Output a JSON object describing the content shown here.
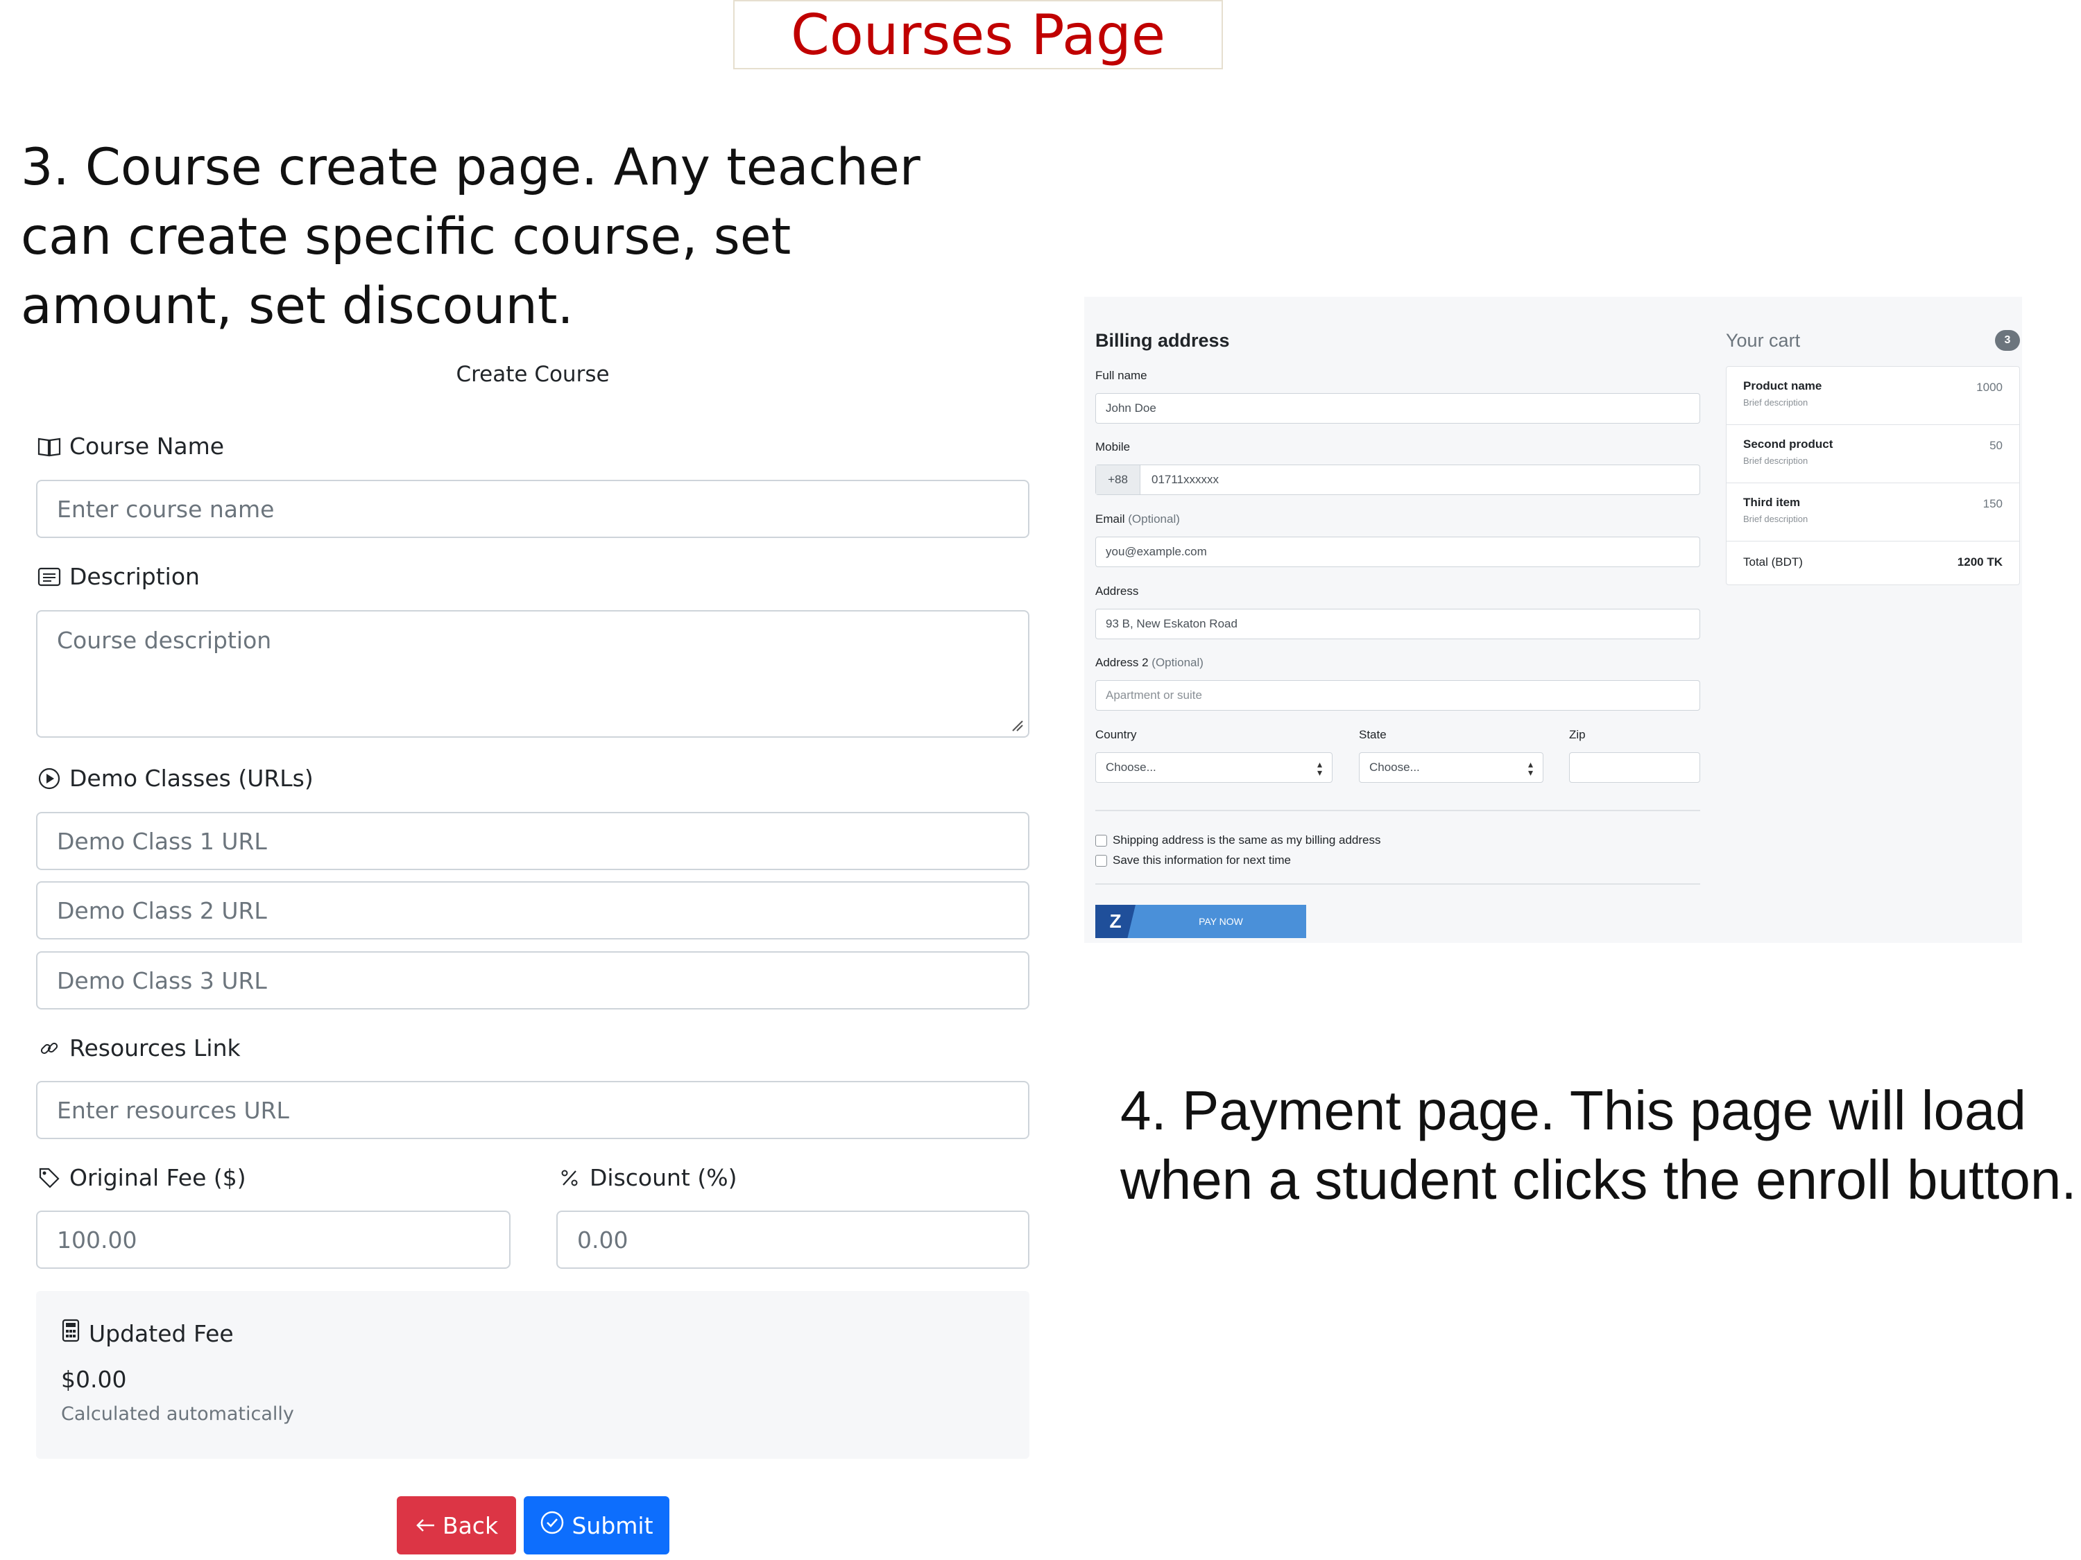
{
  "slide": {
    "title": "Courses Page",
    "caption_left": "3. Course create page. Any teacher can create specific course, set amount, set discount.",
    "caption_right": "4. Payment page. This page will load when a student clicks the enroll button."
  },
  "create_course": {
    "heading": "Create Course",
    "course_name": {
      "label": "Course Name",
      "icon": "book-icon",
      "placeholder": "Enter course name"
    },
    "description": {
      "label": "Description",
      "icon": "text-icon",
      "placeholder": "Course description"
    },
    "demo_classes": {
      "label": "Demo Classes (URLs)",
      "icon": "play-circle-icon",
      "placeholders": [
        "Demo Class 1 URL",
        "Demo Class 2 URL",
        "Demo Class 3 URL"
      ]
    },
    "resources": {
      "label": "Resources Link",
      "icon": "link-icon",
      "placeholder": "Enter resources URL"
    },
    "original_fee": {
      "label": "Original Fee ($)",
      "icon": "tag-icon",
      "value": "100.00"
    },
    "discount": {
      "label": "Discount (%)",
      "icon": "percent-icon",
      "value": "0.00"
    },
    "updated_fee": {
      "label": "Updated Fee",
      "icon": "calculator-icon",
      "value": "$0.00",
      "note": "Calculated automatically"
    },
    "back_button": "Back",
    "submit_button": "Submit"
  },
  "payment": {
    "billing_heading": "Billing address",
    "full_name": {
      "label": "Full name",
      "value": "John Doe"
    },
    "mobile": {
      "label": "Mobile",
      "prefix": "+88",
      "value": "01711xxxxxx"
    },
    "email": {
      "label": "Email",
      "optional": "(Optional)",
      "placeholder": "you@example.com"
    },
    "address": {
      "label": "Address",
      "value": "93 B, New Eskaton Road"
    },
    "address2": {
      "label": "Address 2",
      "optional": "(Optional)",
      "placeholder": "Apartment or suite"
    },
    "country": {
      "label": "Country",
      "selected": "Choose..."
    },
    "state": {
      "label": "State",
      "selected": "Choose..."
    },
    "zip": {
      "label": "Zip",
      "value": ""
    },
    "checkboxes": [
      "Shipping address is the same as my billing address",
      "Save this information for next time"
    ],
    "pay_button": {
      "logo": "Z",
      "label": "PAY NOW"
    },
    "cart": {
      "heading": "Your cart",
      "count": "3",
      "items": [
        {
          "name": "Product name",
          "desc": "Brief description",
          "price": "1000"
        },
        {
          "name": "Second product",
          "desc": "Brief description",
          "price": "50"
        },
        {
          "name": "Third item",
          "desc": "Brief description",
          "price": "150"
        }
      ],
      "total_label": "Total (BDT)",
      "total_value": "1200 TK"
    }
  },
  "colors": {
    "title_red": "#c00000",
    "back_red": "#dc3545",
    "submit_blue": "#0d6efd",
    "pay_blue": "#4a90d9"
  }
}
